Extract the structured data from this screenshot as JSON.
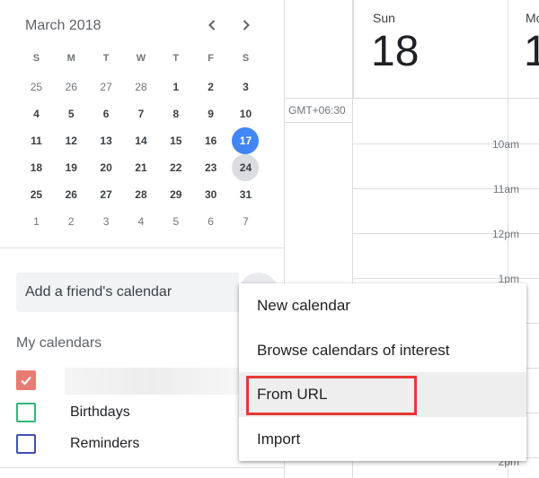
{
  "mini_calendar": {
    "month_label": "March 2018",
    "weekdays": [
      "S",
      "M",
      "T",
      "W",
      "T",
      "F",
      "S"
    ],
    "weeks": [
      [
        "25",
        "26",
        "27",
        "28",
        "1",
        "2",
        "3"
      ],
      [
        "4",
        "5",
        "6",
        "7",
        "8",
        "9",
        "10"
      ],
      [
        "11",
        "12",
        "13",
        "14",
        "15",
        "16",
        "17"
      ],
      [
        "18",
        "19",
        "20",
        "21",
        "22",
        "23",
        "24"
      ],
      [
        "25",
        "26",
        "27",
        "28",
        "29",
        "30",
        "31"
      ],
      [
        "1",
        "2",
        "3",
        "4",
        "5",
        "6",
        "7"
      ]
    ],
    "today": "17",
    "selected": "24",
    "prev_icon": "chevron-left-icon",
    "next_icon": "chevron-right-icon"
  },
  "sidebar": {
    "friend_placeholder": "Add a friend's calendar",
    "my_calendars_heading": "My calendars",
    "calendars": [
      {
        "label": "",
        "color": "#e67c73",
        "checked": true
      },
      {
        "label": "Birthdays",
        "color": "#33b679",
        "checked": false
      },
      {
        "label": "Reminders",
        "color": "#3f51b5",
        "checked": false
      }
    ]
  },
  "main": {
    "day1_name": "Sun",
    "day1_number": "18",
    "day2_name": "Mo",
    "day2_number": "1",
    "timezone": "GMT+06:30",
    "hours": [
      "10am",
      "11am",
      "12pm",
      "1pm",
      "2pm"
    ]
  },
  "menu": {
    "items": [
      "New calendar",
      "Browse calendars of interest",
      "From URL",
      "Import"
    ],
    "highlighted_index": 2,
    "highlight_color": "#e53935"
  },
  "colors": {
    "today_accent": "#4285f4",
    "selected_day_bg": "#dadce0"
  }
}
